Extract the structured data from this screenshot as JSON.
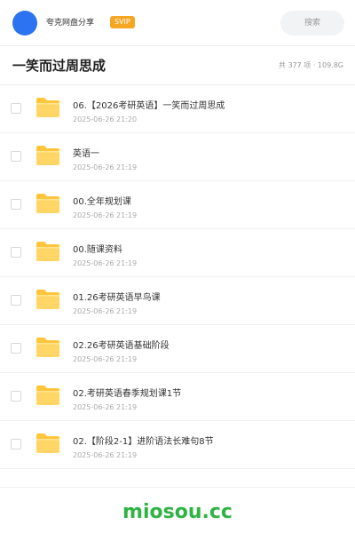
{
  "header": {
    "username": "夸克网盘分享",
    "badge": "SVIP",
    "search_placeholder": "搜索"
  },
  "folder": {
    "title": "一笑而过周思成",
    "summary": "共 377 项 · 109.8G"
  },
  "files": [
    {
      "name": "06.【2026考研英语】一笑而过周思成",
      "date": "2025-06-26 21:20",
      "icon": "folder-icon"
    },
    {
      "name": "英语一",
      "date": "2025-06-26 21:19",
      "icon": "folder-icon"
    },
    {
      "name": "00.全年规划课",
      "date": "2025-06-26 21:19",
      "icon": "folder-icon"
    },
    {
      "name": "00.随课资料",
      "date": "2025-06-26 21:19",
      "icon": "folder-icon"
    },
    {
      "name": "01.26考研英语早鸟课",
      "date": "2025-06-26 21:19",
      "icon": "folder-icon"
    },
    {
      "name": "02.26考研英语基础阶段",
      "date": "2025-06-26 21:19",
      "icon": "folder-icon"
    },
    {
      "name": "02.考研英语春季规划课1节",
      "date": "2025-06-26 21:19",
      "icon": "folder-icon"
    },
    {
      "name": "02.【阶段2-1】进阶语法长难句8节",
      "date": "2025-06-26 21:19",
      "icon": "folder-icon"
    }
  ],
  "footer": {
    "watermark": "miosou.cc"
  },
  "colors": {
    "avatar": "#2b73f0",
    "badge": "#f5a623",
    "folder": "#ffc53d",
    "watermark": "#2fb344"
  }
}
